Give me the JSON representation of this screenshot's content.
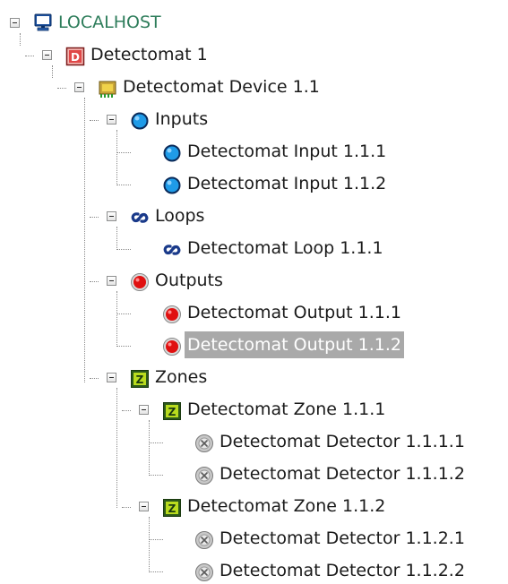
{
  "tree": {
    "nodes": [
      {
        "label": "LOCALHOST",
        "icon": "computer-icon",
        "expanded": true
      },
      {
        "label": "Detectomat 1",
        "icon": "detectomat-panel-icon",
        "expanded": true
      },
      {
        "label": "Detectomat Device 1.1",
        "icon": "device-chip-icon",
        "expanded": true
      },
      {
        "label": "Inputs",
        "icon": "input-circle-icon",
        "expanded": true
      },
      {
        "label": "Detectomat Input 1.1.1",
        "icon": "input-circle-icon"
      },
      {
        "label": "Detectomat Input 1.1.2",
        "icon": "input-circle-icon"
      },
      {
        "label": "Loops",
        "icon": "loop-icon",
        "expanded": true
      },
      {
        "label": "Detectomat Loop 1.1.1",
        "icon": "loop-icon"
      },
      {
        "label": "Outputs",
        "icon": "output-red-icon",
        "expanded": true
      },
      {
        "label": "Detectomat Output 1.1.1",
        "icon": "output-red-icon"
      },
      {
        "label": "Detectomat Output 1.1.2",
        "icon": "output-red-icon",
        "selected": true
      },
      {
        "label": "Zones",
        "icon": "zone-icon",
        "expanded": true
      },
      {
        "label": "Detectomat Zone 1.1.1",
        "icon": "zone-icon",
        "expanded": true
      },
      {
        "label": "Detectomat Detector 1.1.1.1",
        "icon": "detector-icon"
      },
      {
        "label": "Detectomat Detector 1.1.1.2",
        "icon": "detector-icon"
      },
      {
        "label": "Detectomat Zone 1.1.2",
        "icon": "zone-icon",
        "expanded": true
      },
      {
        "label": "Detectomat Detector 1.1.2.1",
        "icon": "detector-icon"
      },
      {
        "label": "Detectomat Detector 1.1.2.2",
        "icon": "detector-icon"
      }
    ]
  },
  "colors": {
    "root_text": "#2e7d5b",
    "selection_bg": "#a9a9a9",
    "selection_text": "#ffffff",
    "input_blue": "#1f9be8",
    "output_red": "#e01010",
    "zone_green": "#b9dc1e",
    "panel_red": "#d93a3a"
  }
}
